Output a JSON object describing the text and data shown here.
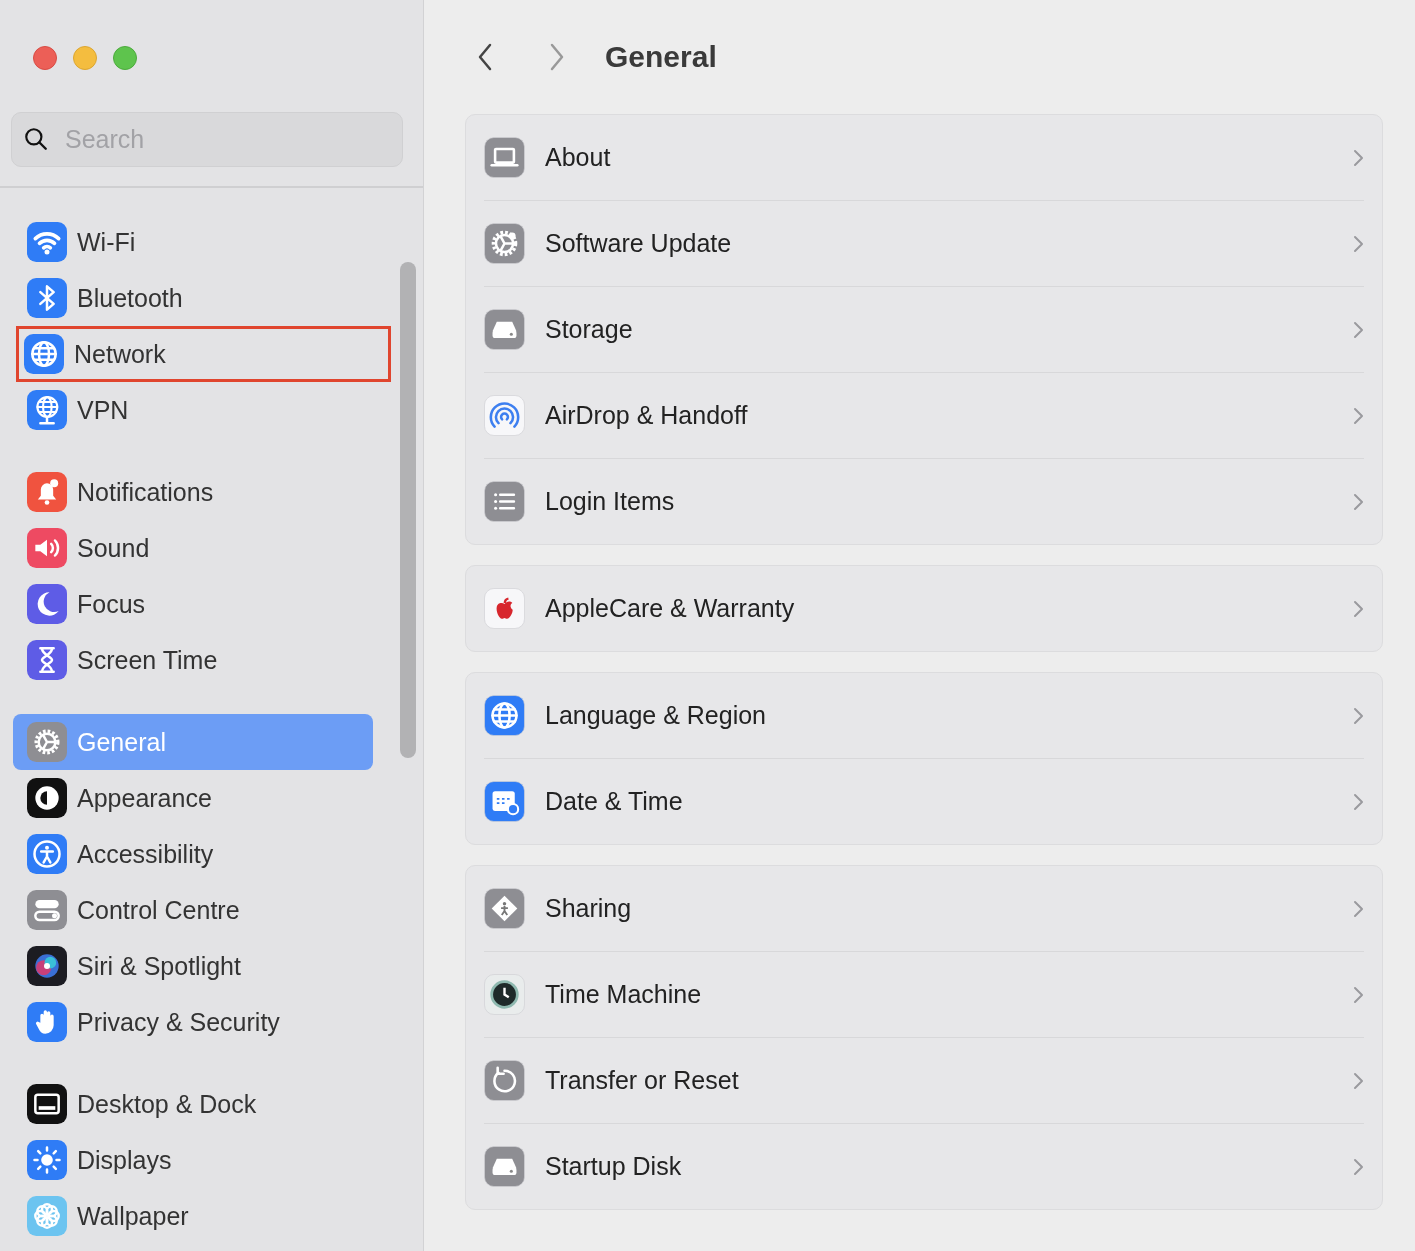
{
  "sidebar": {
    "search": {
      "placeholder": "Search"
    },
    "groups": [
      {
        "items": [
          {
            "label": "Wi-Fi",
            "selected": false,
            "outlined": false
          },
          {
            "label": "Bluetooth",
            "selected": false,
            "outlined": false
          },
          {
            "label": "Network",
            "selected": false,
            "outlined": true
          },
          {
            "label": "VPN",
            "selected": false,
            "outlined": false
          }
        ]
      },
      {
        "items": [
          {
            "label": "Notifications",
            "selected": false,
            "outlined": false
          },
          {
            "label": "Sound",
            "selected": false,
            "outlined": false
          },
          {
            "label": "Focus",
            "selected": false,
            "outlined": false
          },
          {
            "label": "Screen Time",
            "selected": false,
            "outlined": false
          }
        ]
      },
      {
        "items": [
          {
            "label": "General",
            "selected": true,
            "outlined": false
          },
          {
            "label": "Appearance",
            "selected": false,
            "outlined": false
          },
          {
            "label": "Accessibility",
            "selected": false,
            "outlined": false
          },
          {
            "label": "Control Centre",
            "selected": false,
            "outlined": false
          },
          {
            "label": "Siri & Spotlight",
            "selected": false,
            "outlined": false
          },
          {
            "label": "Privacy & Security",
            "selected": false,
            "outlined": false
          }
        ]
      },
      {
        "items": [
          {
            "label": "Desktop & Dock",
            "selected": false,
            "outlined": false
          },
          {
            "label": "Displays",
            "selected": false,
            "outlined": false
          },
          {
            "label": "Wallpaper",
            "selected": false,
            "outlined": false
          }
        ]
      }
    ]
  },
  "header": {
    "title": "General"
  },
  "sections": [
    {
      "rows": [
        {
          "label": "About"
        },
        {
          "label": "Software Update"
        },
        {
          "label": "Storage"
        },
        {
          "label": "AirDrop & Handoff"
        },
        {
          "label": "Login Items"
        }
      ]
    },
    {
      "rows": [
        {
          "label": "AppleCare & Warranty"
        }
      ]
    },
    {
      "rows": [
        {
          "label": "Language & Region"
        },
        {
          "label": "Date & Time"
        }
      ]
    },
    {
      "rows": [
        {
          "label": "Sharing"
        },
        {
          "label": "Time Machine"
        },
        {
          "label": "Transfer or Reset"
        },
        {
          "label": "Startup Disk"
        }
      ]
    }
  ]
}
